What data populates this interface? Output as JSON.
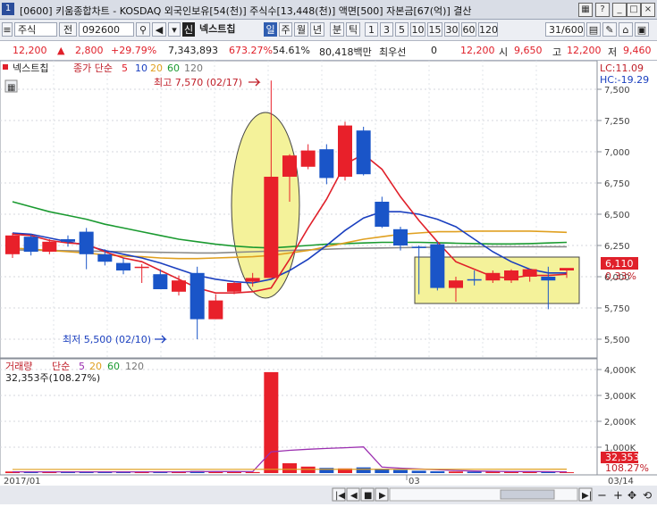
{
  "window": {
    "number": "1",
    "title": "[0600] 키움종합차트 - KOSDAQ 외국인보유[54(천)] 주식수[13,448(천)] 액면[500] 자본금[67(억)] 결산"
  },
  "toolbar": {
    "market": "주식",
    "prev_label": "전",
    "code": "092600",
    "name_badge": "신",
    "stock_name": "넥스트칩",
    "periods": [
      "일",
      "주",
      "월",
      "년",
      "분",
      "틱"
    ],
    "selected_period": "일",
    "minutes": [
      "1",
      "3",
      "5",
      "10",
      "15",
      "30",
      "60",
      "120"
    ],
    "count": "31/600"
  },
  "quote": {
    "price": "12,200",
    "change": "2,800",
    "change_pct": "+29.79%",
    "volume": "7,343,893",
    "vol_ratio": "673.27%",
    "turnover": "54.61%",
    "amount": "80,418백만",
    "best_label": "최우선",
    "best_val": "0",
    "best_price": "12,200",
    "open_label": "시",
    "open": "9,650",
    "high_label": "고",
    "high": "12,200",
    "low_label": "저",
    "low": "9,460"
  },
  "chart_data": [
    {
      "type": "candlestick",
      "title": "넥스트칩",
      "legend": {
        "label": "종가 단순",
        "periods": [
          "5",
          "10",
          "20",
          "60",
          "120"
        ]
      },
      "ylim": [
        5350,
        7550
      ],
      "yticks": [
        "7,500",
        "7,250",
        "7,000",
        "6,750",
        "6,500",
        "6,250",
        "6,000",
        "5,750",
        "5,500"
      ],
      "x_labels": [
        "2017/01",
        "03",
        "03/14"
      ],
      "candles": [
        {
          "o": 6180,
          "h": 6350,
          "l": 6150,
          "c": 6330
        },
        {
          "o": 6320,
          "h": 6340,
          "l": 6170,
          "c": 6200
        },
        {
          "o": 6200,
          "h": 6300,
          "l": 6180,
          "c": 6280
        },
        {
          "o": 6300,
          "h": 6330,
          "l": 6240,
          "c": 6280
        },
        {
          "o": 6360,
          "h": 6390,
          "l": 6060,
          "c": 6180
        },
        {
          "o": 6180,
          "h": 6220,
          "l": 6090,
          "c": 6120
        },
        {
          "o": 6110,
          "h": 6150,
          "l": 6020,
          "c": 6050
        },
        {
          "o": 6080,
          "h": 6100,
          "l": 5950,
          "c": 6080
        },
        {
          "o": 6020,
          "h": 6060,
          "l": 5900,
          "c": 5900
        },
        {
          "o": 5880,
          "h": 6010,
          "l": 5850,
          "c": 5970
        },
        {
          "o": 6030,
          "h": 6080,
          "l": 5500,
          "c": 5660
        },
        {
          "o": 5660,
          "h": 5860,
          "l": 5660,
          "c": 5810
        },
        {
          "o": 5880,
          "h": 5960,
          "l": 5860,
          "c": 5950
        },
        {
          "o": 5960,
          "h": 6030,
          "l": 5920,
          "c": 5990
        },
        {
          "o": 5990,
          "h": 7570,
          "l": 5990,
          "c": 6800
        },
        {
          "o": 6800,
          "h": 6980,
          "l": 6600,
          "c": 6970
        },
        {
          "o": 6880,
          "h": 7060,
          "l": 6860,
          "c": 7010
        },
        {
          "o": 7020,
          "h": 7060,
          "l": 6740,
          "c": 6790
        },
        {
          "o": 6800,
          "h": 7240,
          "l": 6770,
          "c": 7210
        },
        {
          "o": 7170,
          "h": 7200,
          "l": 6810,
          "c": 6820
        },
        {
          "o": 6600,
          "h": 6640,
          "l": 6390,
          "c": 6400
        },
        {
          "o": 6380,
          "h": 6400,
          "l": 6210,
          "c": 6250
        },
        {
          "o": 6240,
          "h": 6250,
          "l": 5860,
          "c": 6230
        },
        {
          "o": 6260,
          "h": 6280,
          "l": 5890,
          "c": 5910
        },
        {
          "o": 5910,
          "h": 6000,
          "l": 5800,
          "c": 5970
        },
        {
          "o": 5980,
          "h": 6050,
          "l": 5930,
          "c": 5970
        },
        {
          "o": 5970,
          "h": 6050,
          "l": 5950,
          "c": 6030
        },
        {
          "o": 5970,
          "h": 6060,
          "l": 5950,
          "c": 6050
        },
        {
          "o": 6000,
          "h": 6060,
          "l": 5960,
          "c": 6060
        },
        {
          "o": 6000,
          "h": 6080,
          "l": 5740,
          "c": 5970
        },
        {
          "o": 6050,
          "h": 6060,
          "l": 5990,
          "c": 6070
        }
      ],
      "ma5": [
        6340,
        6330,
        6290,
        6270,
        6260,
        6200,
        6150,
        6120,
        6050,
        5980,
        5910,
        5870,
        5870,
        5880,
        5910,
        6140,
        6390,
        6620,
        6900,
        6980,
        6860,
        6640,
        6450,
        6280,
        6120,
        6060,
        6000,
        5990,
        6010,
        6010,
        6020
      ],
      "ma10": [
        6350,
        6340,
        6310,
        6280,
        6250,
        6210,
        6180,
        6150,
        6110,
        6060,
        6010,
        5980,
        5960,
        5950,
        5980,
        6050,
        6140,
        6250,
        6370,
        6470,
        6520,
        6520,
        6500,
        6460,
        6400,
        6300,
        6200,
        6120,
        6060,
        6030,
        6030
      ],
      "ma20": [
        6230,
        6220,
        6210,
        6200,
        6190,
        6175,
        6165,
        6160,
        6150,
        6145,
        6145,
        6150,
        6155,
        6160,
        6170,
        6190,
        6210,
        6240,
        6270,
        6300,
        6320,
        6340,
        6350,
        6360,
        6360,
        6365,
        6365,
        6365,
        6365,
        6360,
        6355
      ],
      "ma60": [
        6600,
        6560,
        6520,
        6490,
        6460,
        6420,
        6390,
        6360,
        6330,
        6300,
        6280,
        6260,
        6245,
        6235,
        6230,
        6240,
        6250,
        6260,
        6265,
        6270,
        6275,
        6275,
        6275,
        6272,
        6268,
        6265,
        6262,
        6262,
        6265,
        6270,
        6275
      ],
      "ma120": [
        6215,
        6213,
        6210,
        6208,
        6205,
        6203,
        6200,
        6198,
        6195,
        6193,
        6190,
        6190,
        6195,
        6200,
        6205,
        6210,
        6215,
        6220,
        6225,
        6228,
        6230,
        6232,
        6234,
        6236,
        6238,
        6240,
        6240,
        6240,
        6240,
        6240,
        6240
      ],
      "annotations": {
        "high": "최고 7,570 (02/17)",
        "low": "최저 5,500 (02/10)",
        "lc": "LC:11.09",
        "hc": "HC:-19.29",
        "last_price": "6,110",
        "last_pct": "0.33%"
      }
    },
    {
      "type": "bar",
      "title": "거래량",
      "legend": {
        "label": "단순",
        "periods": [
          "5",
          "20",
          "60",
          "120"
        ]
      },
      "summary": "32,353주(108.27%)",
      "ylim": [
        0,
        4200
      ],
      "yticks": [
        "4,000K",
        "3,000K",
        "2,000K",
        "1,000K"
      ],
      "values": [
        60,
        40,
        50,
        45,
        55,
        40,
        35,
        60,
        50,
        45,
        80,
        60,
        45,
        40,
        3900,
        380,
        250,
        200,
        180,
        220,
        170,
        120,
        90,
        70,
        60,
        55,
        50,
        60,
        55,
        45,
        32
      ],
      "ma5": [
        50,
        50,
        50,
        50,
        50,
        48,
        45,
        47,
        49,
        50,
        55,
        58,
        58,
        55,
        820,
        880,
        920,
        950,
        980,
        1010,
        230,
        190,
        160,
        130,
        100,
        80,
        70,
        60,
        58,
        55,
        50
      ],
      "last_value": "32,353",
      "last_pct": "108.27%"
    }
  ]
}
